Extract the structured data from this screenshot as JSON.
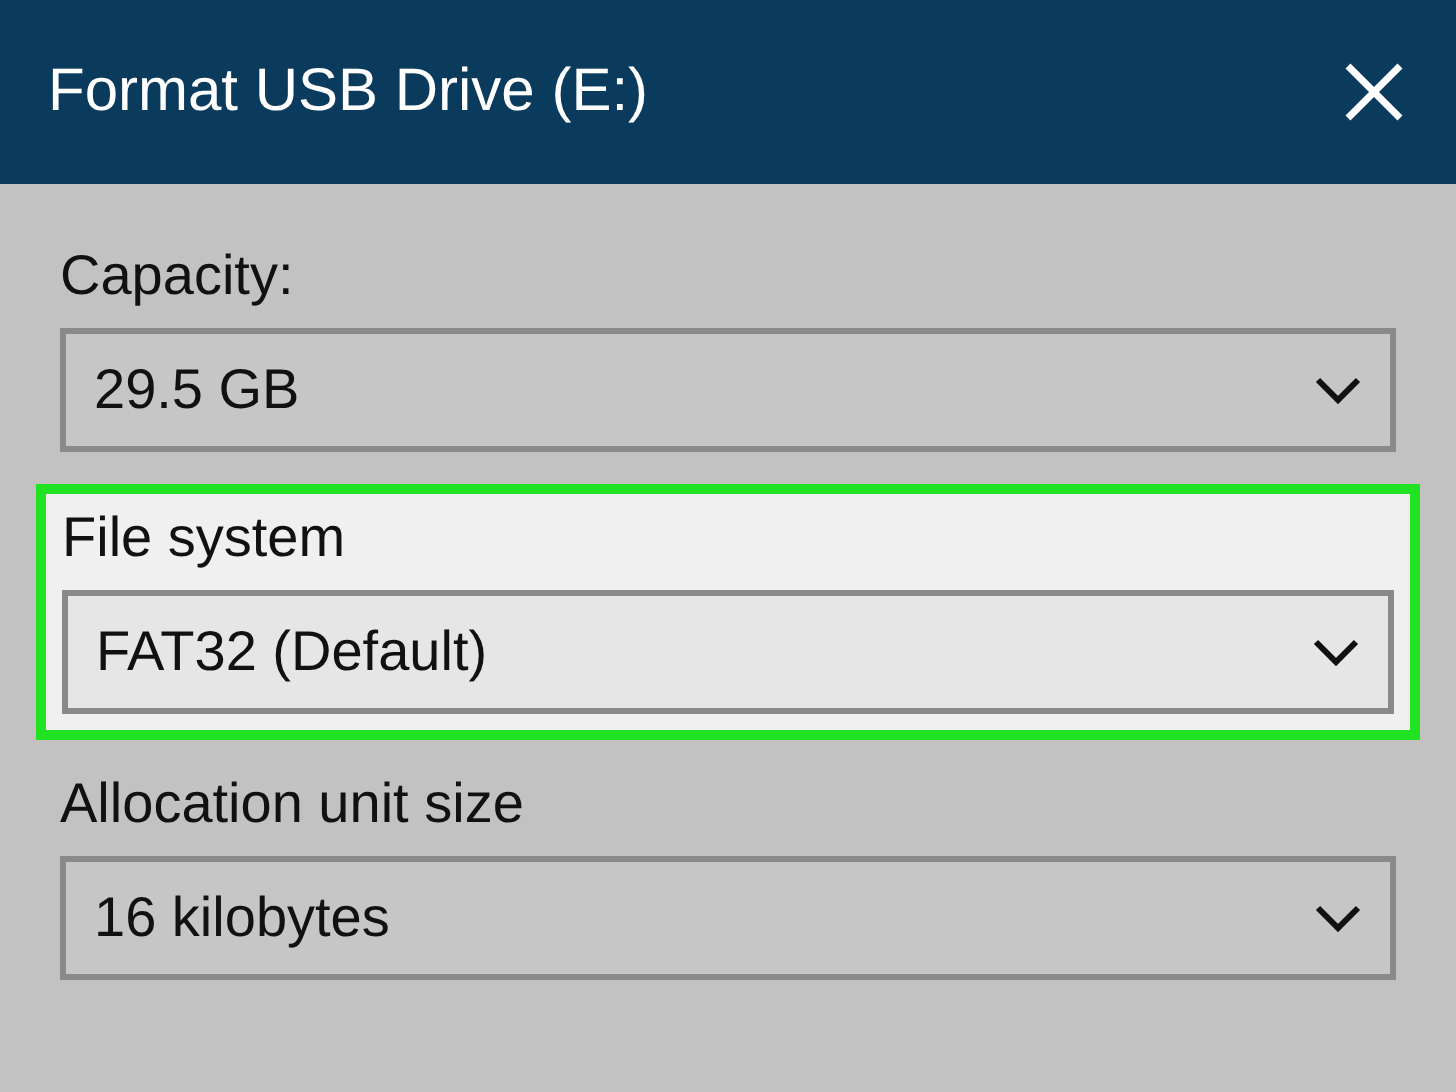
{
  "window": {
    "title": "Format USB Drive (E:)"
  },
  "fields": [
    {
      "label": "Capacity:",
      "value": "29.5 GB",
      "highlighted": false
    },
    {
      "label": "File system",
      "value": "FAT32 (Default)",
      "highlighted": true
    },
    {
      "label": "Allocation unit size",
      "value": "16 kilobytes",
      "highlighted": false
    }
  ]
}
